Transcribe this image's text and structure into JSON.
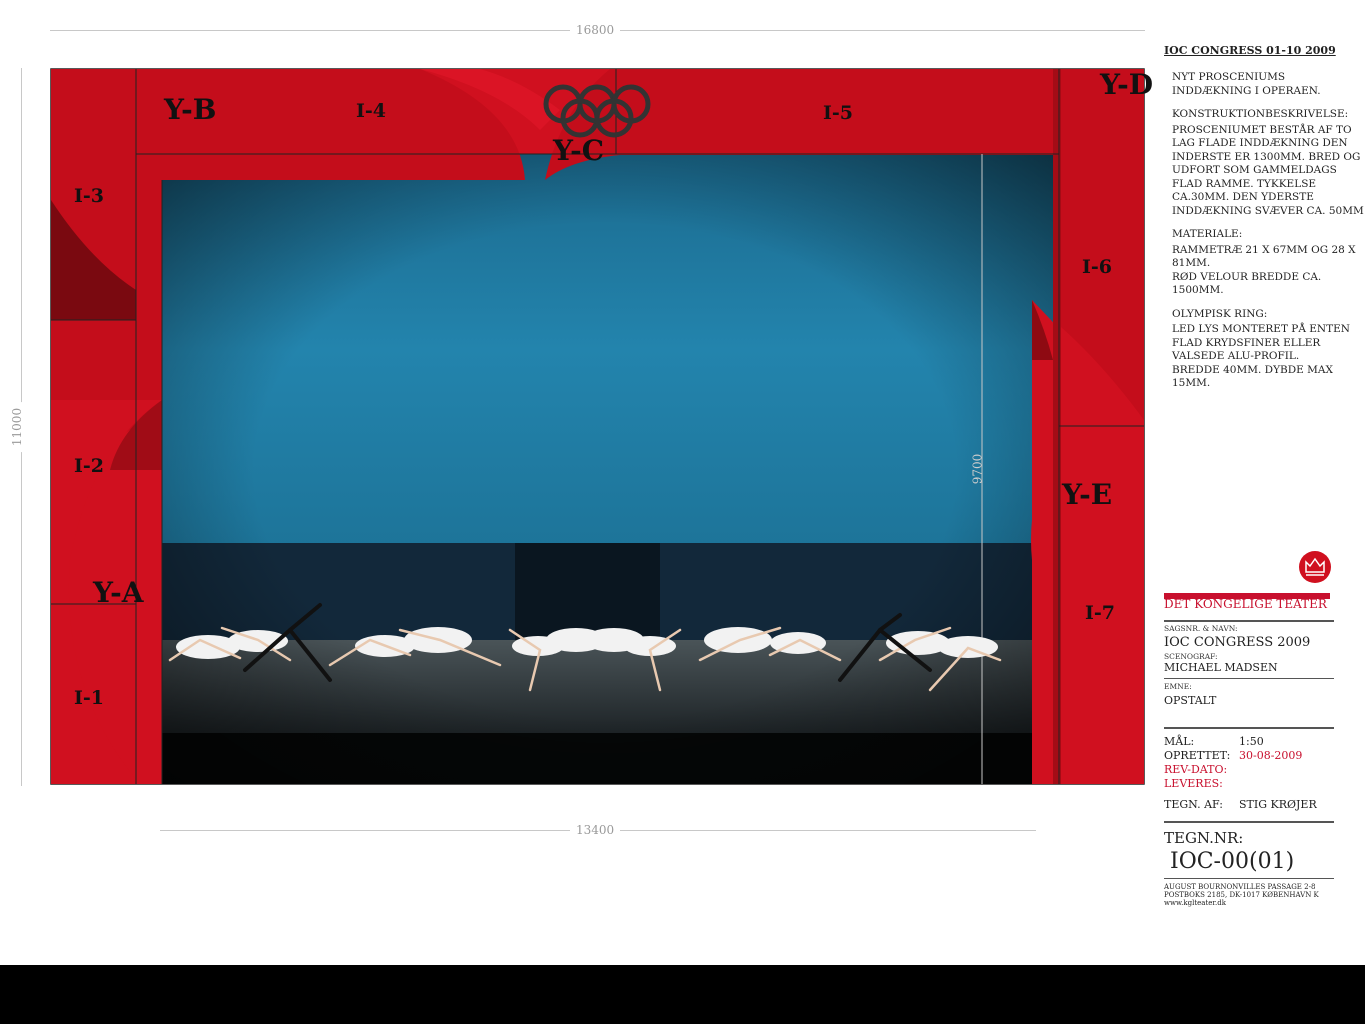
{
  "dimensions": {
    "top_width": "16800",
    "left_height": "11000",
    "bottom_width": "13400",
    "inner_height": "9700"
  },
  "zones": {
    "yb": "Y-B",
    "i4": "I-4",
    "yc": "Y-C",
    "i5": "I-5",
    "yd": "Y-D",
    "i3": "I-3",
    "i2": "I-2",
    "ya": "Y-A",
    "i1": "I-1",
    "i6": "I-6",
    "ye": "Y-E",
    "i7": "I-7"
  },
  "notes": {
    "title": "IOC CONGRESS 01-10 2009",
    "intro": "NYT PROSCENIUMS\nINDDÆKNING I OPERAEN.",
    "construction_heading": "KONSTRUKTIONBESKRIVELSE:",
    "construction": "PROSCENIUMET BESTÅR AF TO\nLAG FLADE INDDÆKNING DEN\nINDERSTE ER 1300MM. BRED OG\nUDFORT SOM GAMMELDAGS\nFLAD RAMME. TYKKELSE\nCA.30MM. DEN YDERSTE\nINDDÆKNING SVÆVER CA. 50MM",
    "material_heading": "MATERIALE:",
    "material": "RAMMETRÆ  21 X 67MM OG 28 X\n81MM.\n RØD VELOUR BREDDE CA.\n1500MM.",
    "ring_heading": "OLYMPISK RING:",
    "ring": "LED LYS MONTERET PÅ ENTEN\nFLAD KRYDSFINER ELLER\nVALSEDE ALU-PROFIL.\nBREDDE 40MM. DYBDE MAX\n15MM."
  },
  "titleblock": {
    "org": "DET KONGELIGE TEATER",
    "case_label": "SAGSNR. & NAVN:",
    "case_value": "IOC CONGRESS 2009",
    "scenographer_label": "SCENOGRAF:",
    "scenographer": "MICHAEL MADSEN",
    "subject_label": "EMNE:",
    "subject": "OPSTALT",
    "scale_label": "MÅL:",
    "scale": "1:50",
    "created_label": "OPRETTET:",
    "created": "30-08-2009",
    "rev_label": "REV-DATO:",
    "deliver_label": "LEVERES:",
    "drawn_label": "TEGN. AF:",
    "drawn_by": "STIG KRØJER",
    "drawing_no_label": "TEGN.NR:",
    "drawing_no": "IOC-00(01)",
    "address1": "AUGUST BOURNONVILLES PASSAGE 2-8",
    "address2": "POSTBOKS 2185, DK-1017 KØBENHAVN K",
    "web": "www.kglteater.dk"
  },
  "colors": {
    "curtain_red": "#d0101f",
    "backdrop_blue": "#1f7fa8",
    "accent_red": "#c8102e"
  },
  "icons": [
    "olympic-rings-icon",
    "crown-logo-icon"
  ]
}
